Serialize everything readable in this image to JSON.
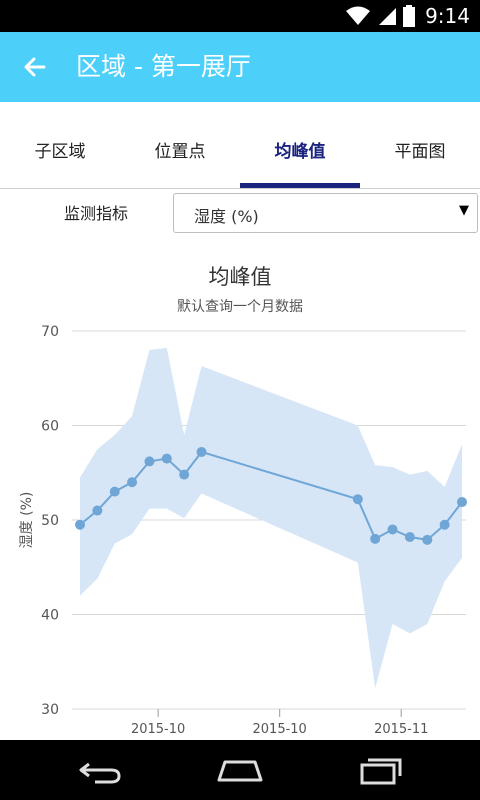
{
  "status_bar": {
    "time": "9:14",
    "icons": [
      "wifi-icon",
      "signal-icon",
      "battery-icon"
    ]
  },
  "app_bar": {
    "title": "区域 - 第一展厅",
    "back_icon": "arrow-left-icon",
    "background": "#4ccff8"
  },
  "tabs": [
    {
      "label": "子区域",
      "active": false
    },
    {
      "label": "位置点",
      "active": false
    },
    {
      "label": "均峰值",
      "active": true
    },
    {
      "label": "平面图",
      "active": false
    }
  ],
  "metric": {
    "label": "监测指标",
    "selected": "湿度 (%)"
  },
  "chart_data": {
    "type": "line",
    "title": "均峰值",
    "subtitle": "默认查询一个月数据",
    "ylabel": "湿度 (%)",
    "xlabel": "",
    "ylim": [
      30,
      70
    ],
    "yticks": [
      30,
      40,
      50,
      60,
      70
    ],
    "xticks": [
      {
        "label": "2015-10",
        "x": 4.5
      },
      {
        "label": "2015-10",
        "x": 11.5
      },
      {
        "label": "2015-11",
        "x": 18.5
      }
    ],
    "xlim": [
      0,
      22
    ],
    "grid": true,
    "colors": {
      "line": "#6fa6d6",
      "range": "#d6e6f7"
    },
    "series": [
      {
        "type": "line",
        "x": [
          0,
          1,
          2,
          3,
          4,
          5,
          6,
          7,
          16,
          17,
          18,
          19,
          20,
          21,
          22
        ],
        "values": [
          49.5,
          51.0,
          53.0,
          54.0,
          56.2,
          56.5,
          54.8,
          57.2,
          52.2,
          48.0,
          49.0,
          48.2,
          47.9,
          49.5,
          51.9
        ]
      },
      {
        "type": "range",
        "x": [
          0,
          1,
          2,
          3,
          4,
          5,
          6,
          7,
          16,
          17,
          18,
          19,
          20,
          21,
          22
        ],
        "low": [
          42.0,
          43.8,
          47.5,
          48.5,
          51.2,
          51.2,
          50.2,
          52.8,
          45.5,
          32.2,
          39.0,
          38.0,
          39.0,
          43.5,
          46.0
        ],
        "high": [
          54.5,
          57.5,
          59.0,
          61.0,
          68.0,
          68.2,
          59.0,
          66.3,
          60.0,
          55.8,
          55.6,
          54.8,
          55.2,
          53.5,
          58.0
        ]
      }
    ]
  }
}
